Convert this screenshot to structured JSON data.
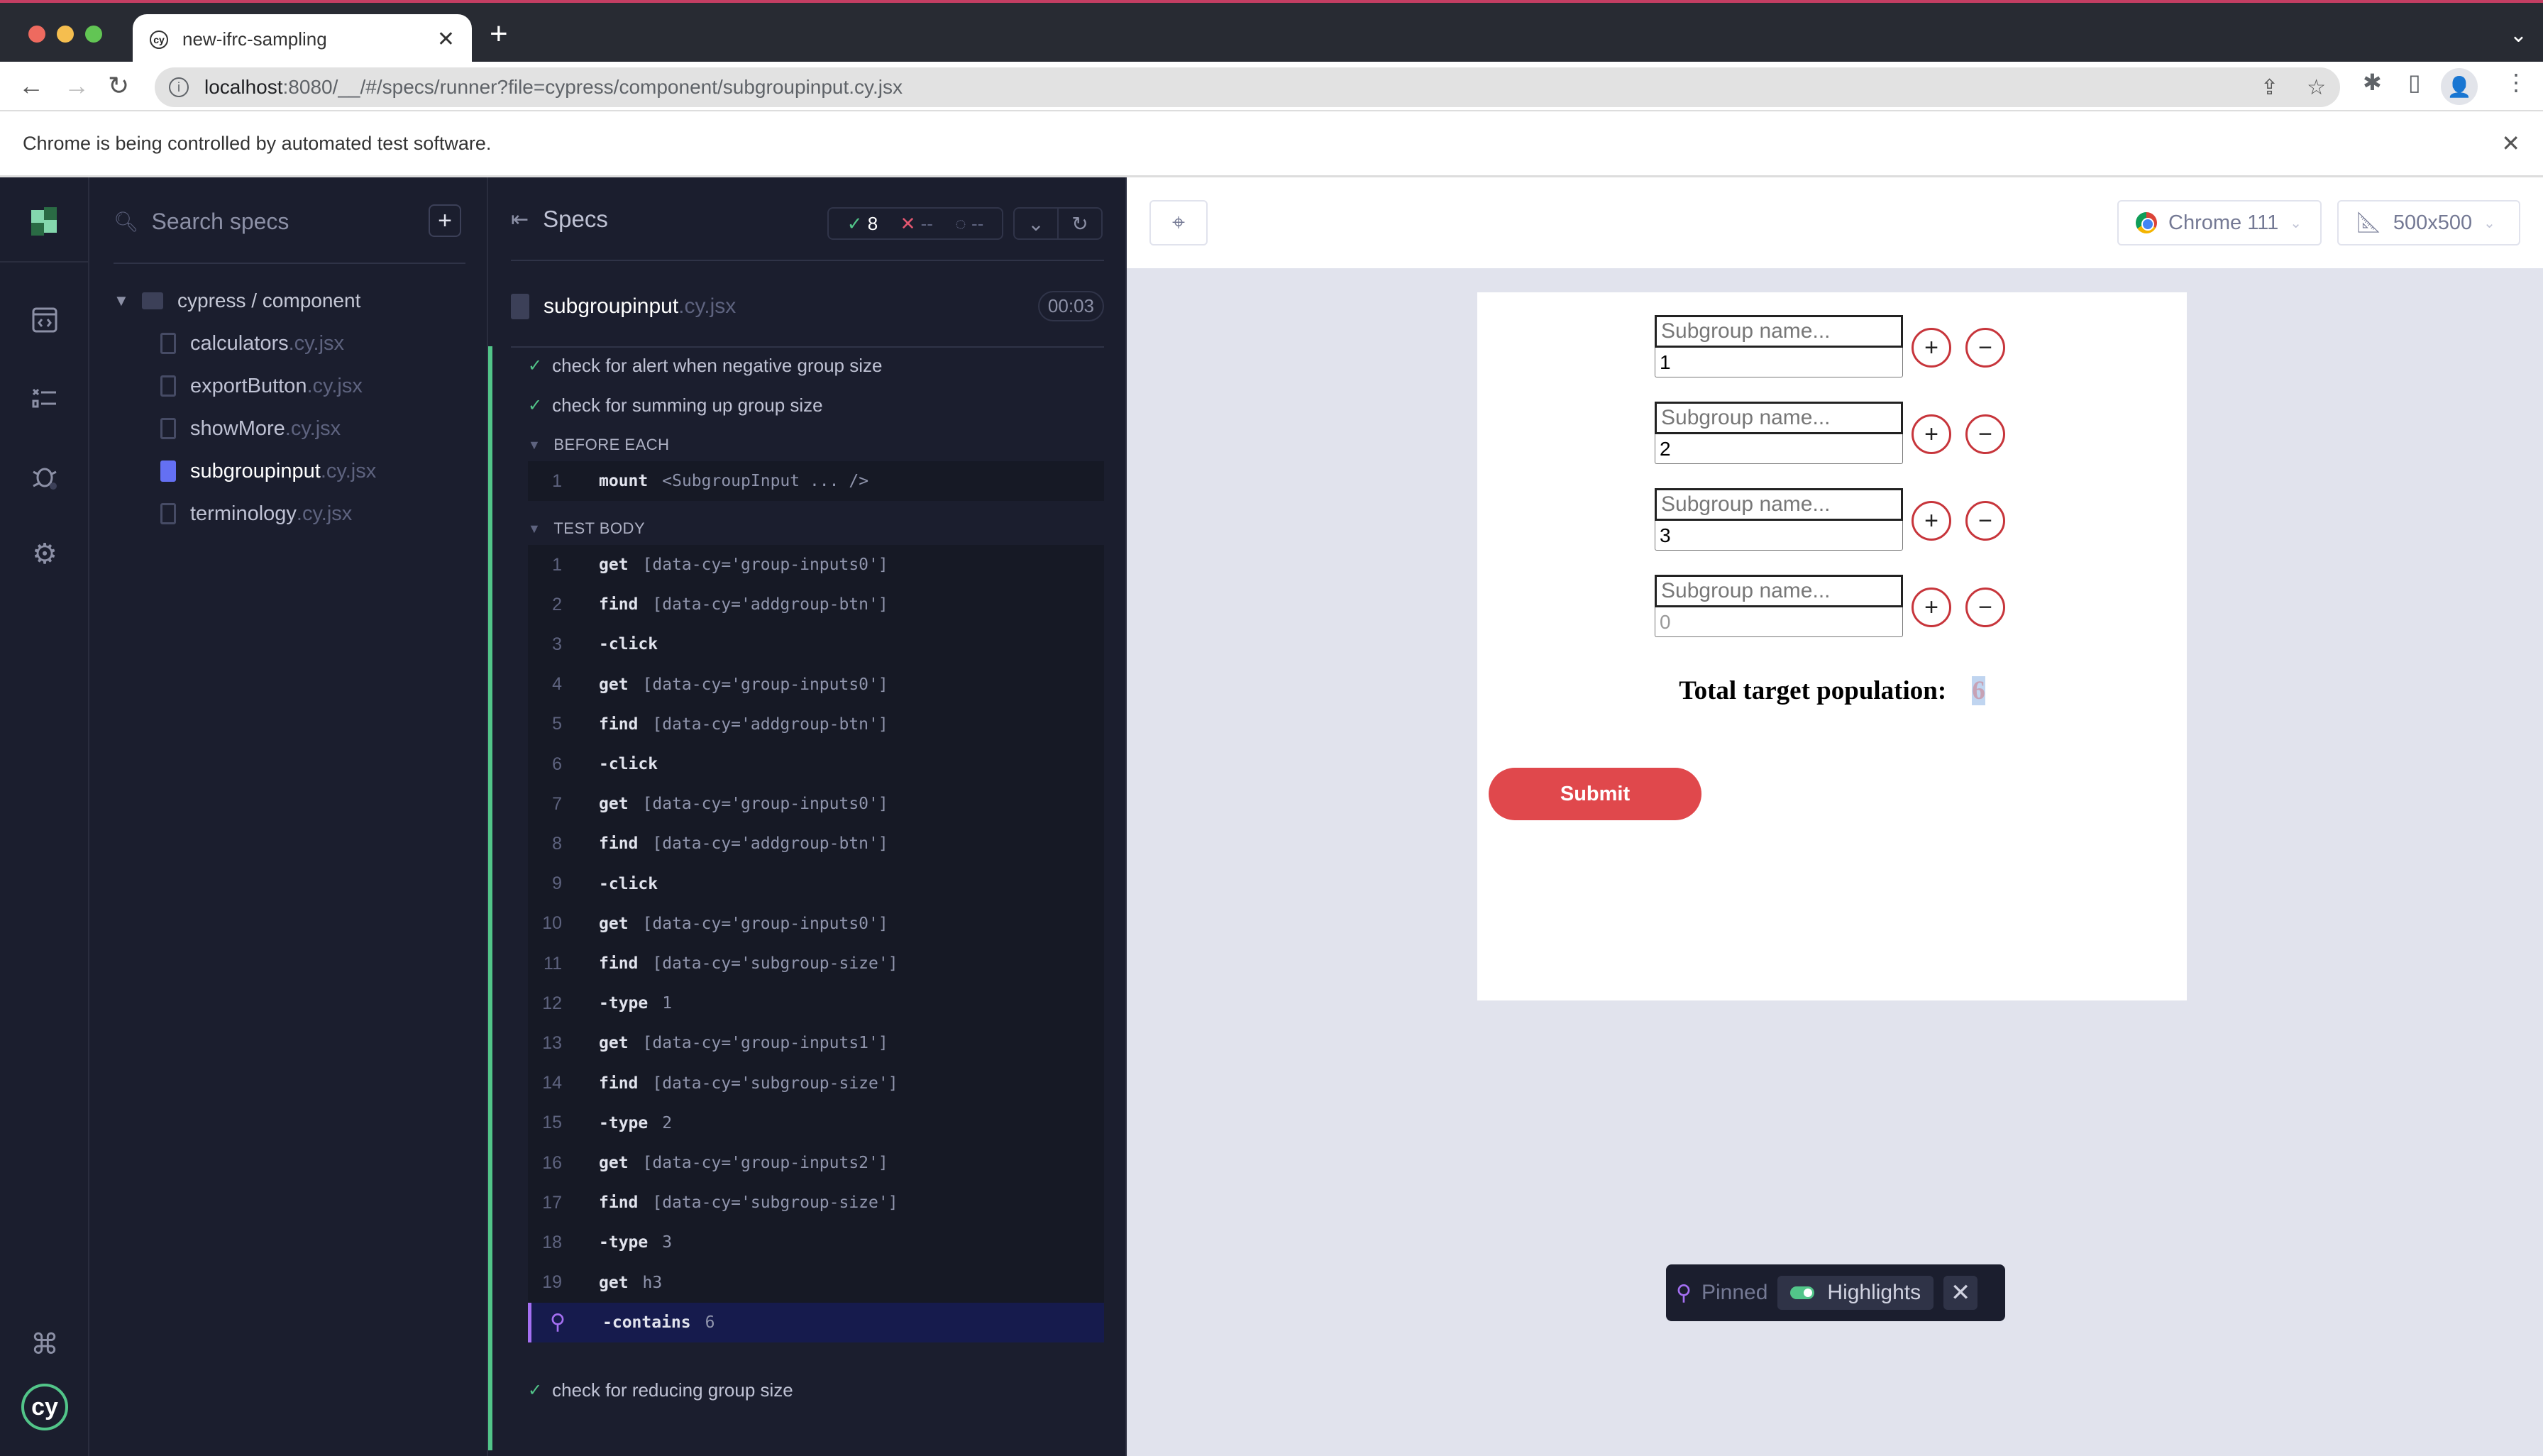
{
  "browser": {
    "tab_title": "new-ifrc-sampling",
    "tab_favicon": "cy",
    "url_host": "localhost",
    "url_rest": ":8080/__/#/specs/runner?file=cypress/component/subgroupinput.cy.jsx",
    "infobar_text": "Chrome is being controlled by automated test software.",
    "icons": [
      "back-icon",
      "forward-icon",
      "reload-icon",
      "info-icon",
      "share-icon",
      "star-icon",
      "extensions-icon",
      "sidepanel-icon",
      "profile-icon",
      "menu-icon"
    ]
  },
  "speclist": {
    "search_placeholder": "Search specs",
    "new_spec_label": "+",
    "folder": "cypress / component",
    "files": [
      {
        "base": "calculators",
        "ext": ".cy.jsx",
        "active": false
      },
      {
        "base": "exportButton",
        "ext": ".cy.jsx",
        "active": false
      },
      {
        "base": "showMore",
        "ext": ".cy.jsx",
        "active": false
      },
      {
        "base": "subgroupinput",
        "ext": ".cy.jsx",
        "active": true
      },
      {
        "base": "terminology",
        "ext": ".cy.jsx",
        "active": false
      }
    ]
  },
  "reporter": {
    "title": "Specs",
    "stats": {
      "passed": "8",
      "failed": "--",
      "pending": "--"
    },
    "spec_base": "subgroupinput",
    "spec_ext": ".cy.jsx",
    "duration": "00:03",
    "tests": [
      "check for alert when negative group size",
      "check for summing up group size",
      "check for reducing group size"
    ],
    "before_each_label": "BEFORE EACH",
    "before_each": [
      {
        "num": "1",
        "name": "mount",
        "msg": "<SubgroupInput ... />"
      }
    ],
    "test_body_label": "TEST BODY",
    "commands": [
      {
        "num": "1",
        "name": "get",
        "msg": "[data-cy='group-inputs0']"
      },
      {
        "num": "2",
        "name": "find",
        "msg": "[data-cy='addgroup-btn']"
      },
      {
        "num": "3",
        "name": "-click",
        "msg": ""
      },
      {
        "num": "4",
        "name": "get",
        "msg": "[data-cy='group-inputs0']"
      },
      {
        "num": "5",
        "name": "find",
        "msg": "[data-cy='addgroup-btn']"
      },
      {
        "num": "6",
        "name": "-click",
        "msg": ""
      },
      {
        "num": "7",
        "name": "get",
        "msg": "[data-cy='group-inputs0']"
      },
      {
        "num": "8",
        "name": "find",
        "msg": "[data-cy='addgroup-btn']"
      },
      {
        "num": "9",
        "name": "-click",
        "msg": ""
      },
      {
        "num": "10",
        "name": "get",
        "msg": "[data-cy='group-inputs0']"
      },
      {
        "num": "11",
        "name": "find",
        "msg": "[data-cy='subgroup-size']"
      },
      {
        "num": "12",
        "name": "-type",
        "msg": "1"
      },
      {
        "num": "13",
        "name": "get",
        "msg": "[data-cy='group-inputs1']"
      },
      {
        "num": "14",
        "name": "find",
        "msg": "[data-cy='subgroup-size']"
      },
      {
        "num": "15",
        "name": "-type",
        "msg": "2"
      },
      {
        "num": "16",
        "name": "get",
        "msg": "[data-cy='group-inputs2']"
      },
      {
        "num": "17",
        "name": "find",
        "msg": "[data-cy='subgroup-size']"
      },
      {
        "num": "18",
        "name": "-type",
        "msg": "3"
      },
      {
        "num": "19",
        "name": "get",
        "msg": "h3"
      },
      {
        "num": "pin",
        "name": "-contains",
        "msg": "6",
        "pinned": true
      }
    ]
  },
  "aut": {
    "browser_label": "Chrome 111",
    "viewport_label": "500x500",
    "subgroups": [
      {
        "name_placeholder": "Subgroup name...",
        "size": "1",
        "size_placeholder": "0"
      },
      {
        "name_placeholder": "Subgroup name...",
        "size": "2",
        "size_placeholder": "0"
      },
      {
        "name_placeholder": "Subgroup name...",
        "size": "3",
        "size_placeholder": "0"
      },
      {
        "name_placeholder": "Subgroup name...",
        "size": "",
        "size_placeholder": "0"
      }
    ],
    "add_label": "+",
    "remove_label": "−",
    "total_label": "Total target population:",
    "total_value": "6",
    "submit_label": "Submit",
    "pinned_label": "Pinned",
    "highlights_label": "Highlights",
    "highlights_on": true
  }
}
